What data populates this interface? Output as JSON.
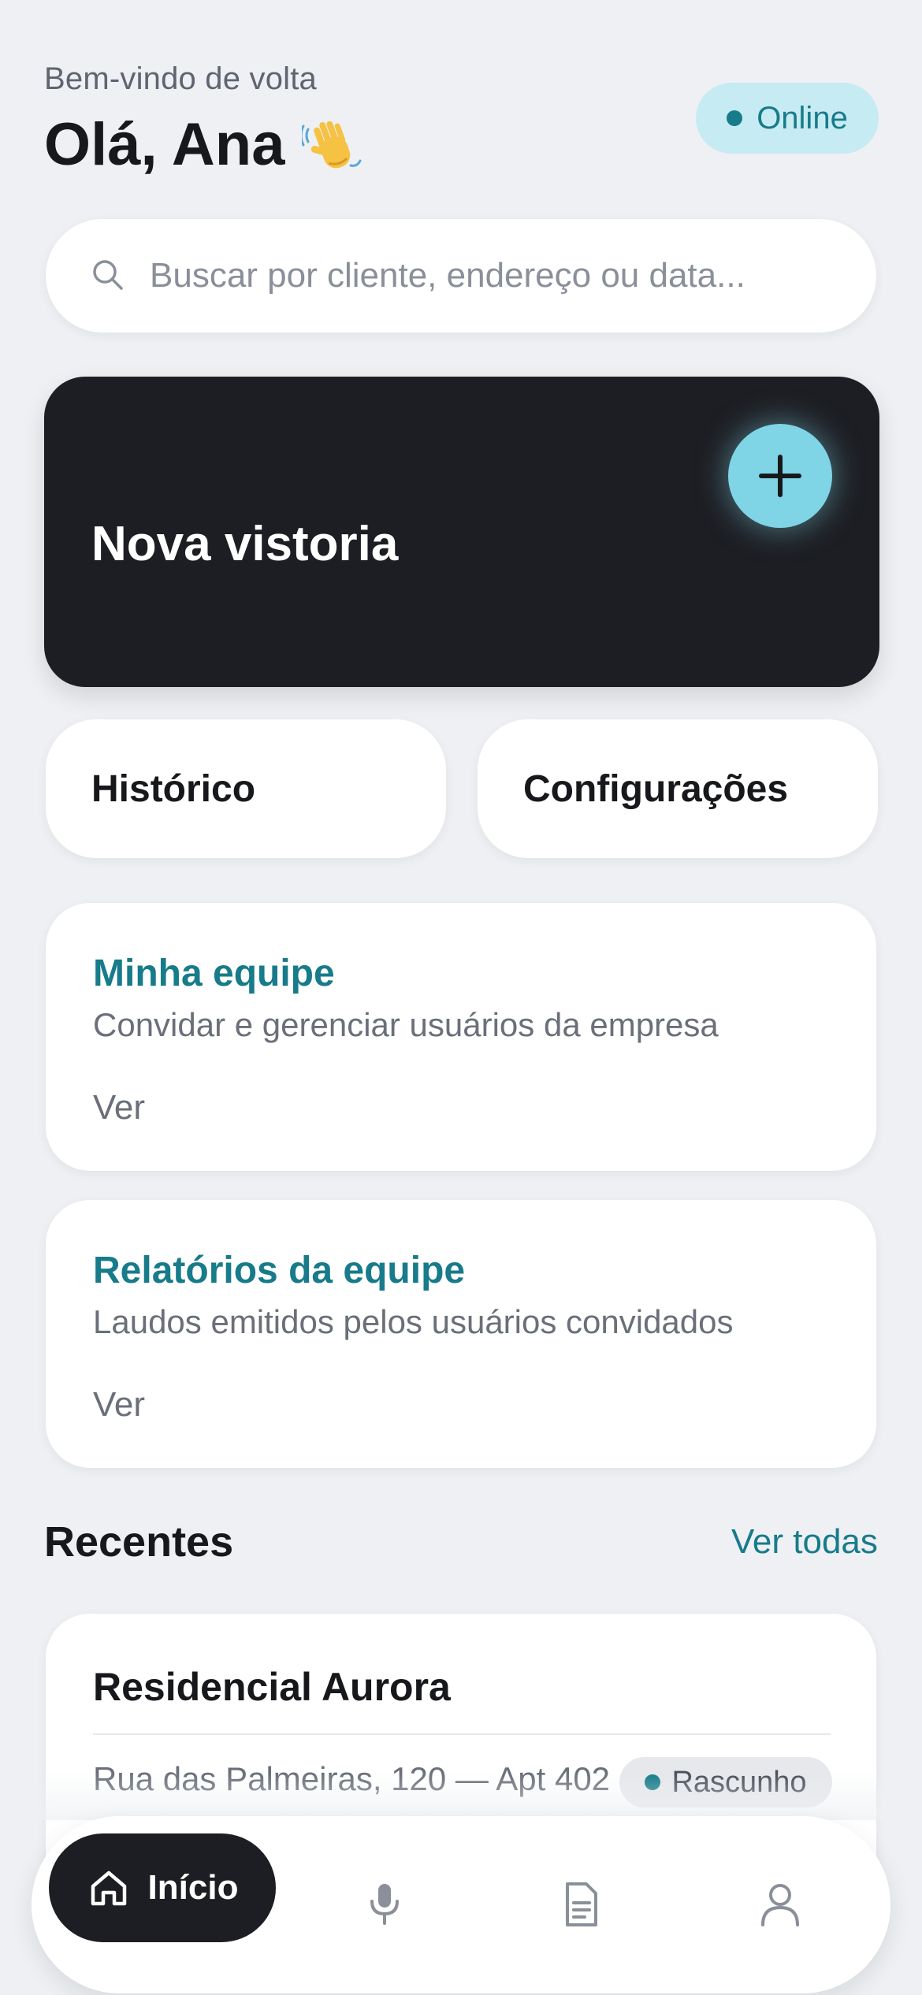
{
  "header": {
    "welcome": "Bem-vindo de volta",
    "greeting": "Olá, Ana",
    "status_label": "Online"
  },
  "search": {
    "placeholder": "Buscar por cliente, endereço ou data..."
  },
  "new_inspection": {
    "title": "Nova vistoria"
  },
  "quick_actions": {
    "history": "Histórico",
    "settings": "Configurações"
  },
  "team_card": {
    "title": "Minha equipe",
    "subtitle": "Convidar e gerenciar usuários da empresa",
    "link": "Ver"
  },
  "team_reports_card": {
    "title": "Relatórios da equipe",
    "subtitle": "Laudos emitidos pelos usuários convidados",
    "link": "Ver"
  },
  "recent": {
    "title": "Recentes",
    "see_all": "Ver todas",
    "items": [
      {
        "name": "Residencial Aurora",
        "address": "Rua das Palmeiras, 120 — Apt 402",
        "status": "Rascunho"
      }
    ]
  },
  "tabbar": {
    "home_label": "Início",
    "icons": [
      "home-icon",
      "microphone-icon",
      "document-icon",
      "user-icon"
    ]
  },
  "colors": {
    "accent": "#177b8a",
    "dark_card": "#1d1e23",
    "plus_button": "#7fd4e6",
    "online_badge_bg": "#c7ebf2",
    "background": "#eef0f3"
  }
}
